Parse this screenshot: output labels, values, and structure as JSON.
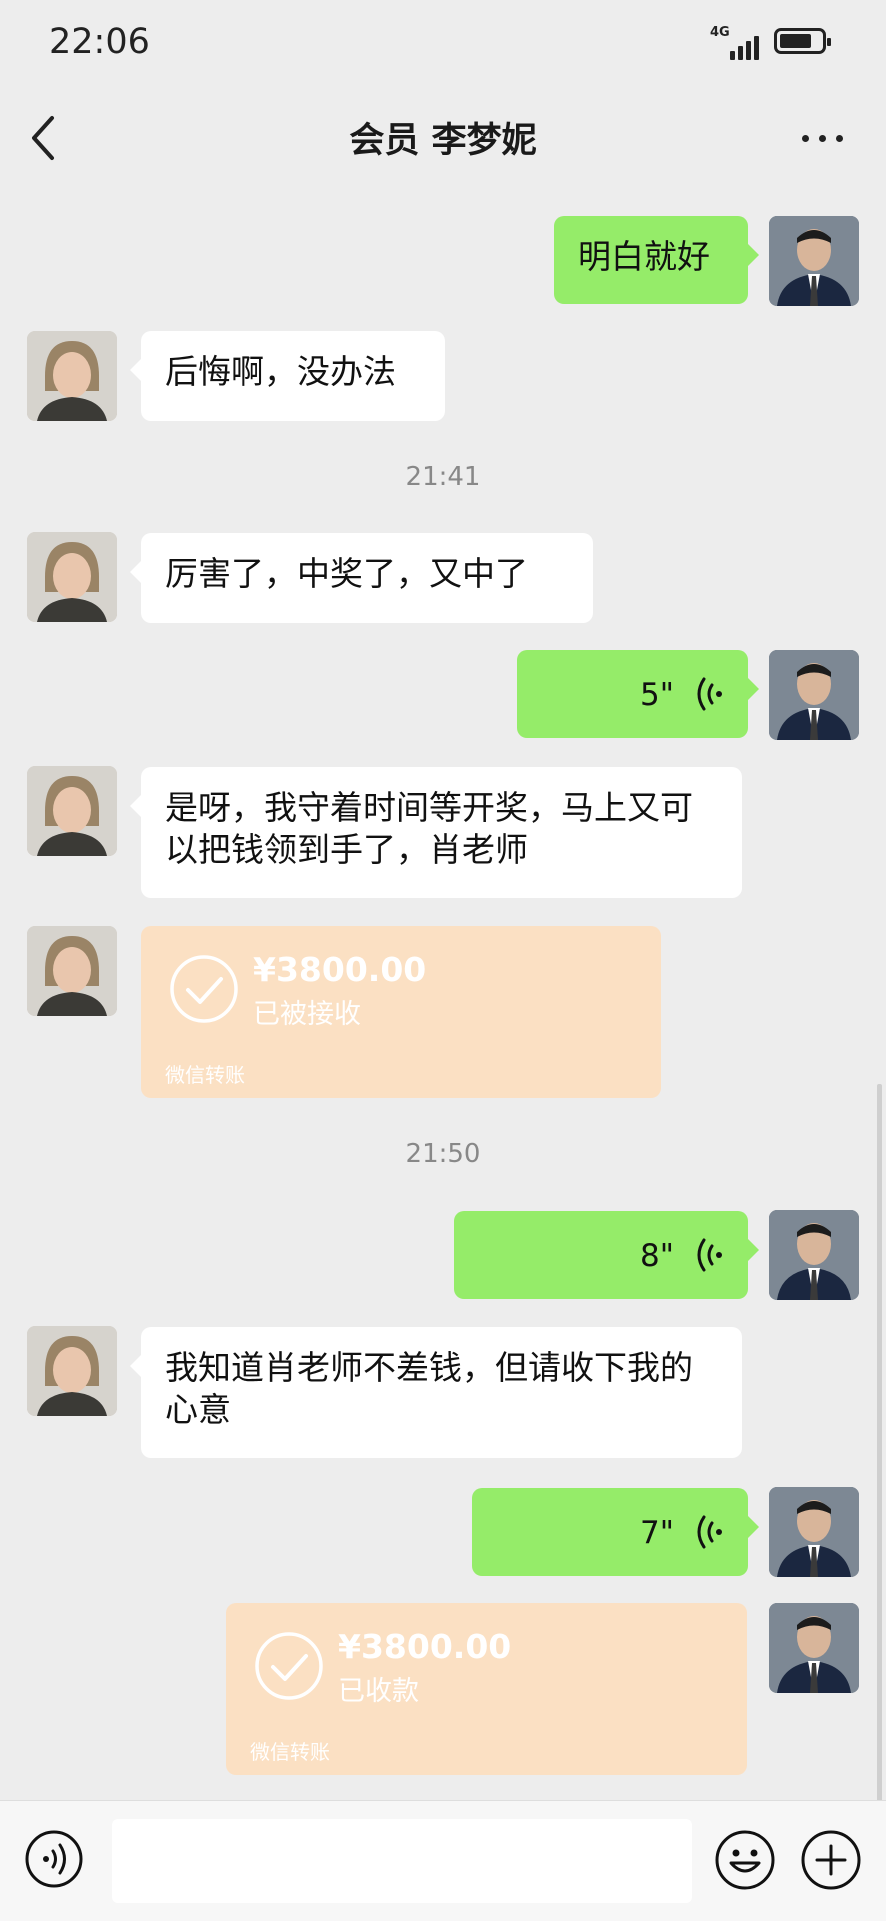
{
  "status_bar": {
    "time": "22:06",
    "network": "4G"
  },
  "header": {
    "title": "会员 李梦妮"
  },
  "messages": {
    "m1": {
      "text": "明白就好"
    },
    "m2": {
      "text": "后悔啊，没办法"
    },
    "ts1": "21:41",
    "m3": {
      "text": "厉害了，中奖了，又中了"
    },
    "v1": {
      "duration": "5\""
    },
    "m4": {
      "text": "是呀，我守着时间等开奖，马上又可以把钱领到手了，肖老师"
    },
    "t1": {
      "amount": "¥3800.00",
      "status": "已被接收",
      "footer": "微信转账"
    },
    "ts2": "21:50",
    "v2": {
      "duration": "8\""
    },
    "m5": {
      "text": "我知道肖老师不差钱，但请收下我的心意"
    },
    "v3": {
      "duration": "7\""
    },
    "t2": {
      "amount": "¥3800.00",
      "status": "已收款",
      "footer": "微信转账"
    }
  },
  "colors": {
    "sent_bubble": "#95ec69",
    "received_bubble": "#ffffff",
    "transfer_card": "#fbe0c3",
    "background": "#ededed"
  }
}
